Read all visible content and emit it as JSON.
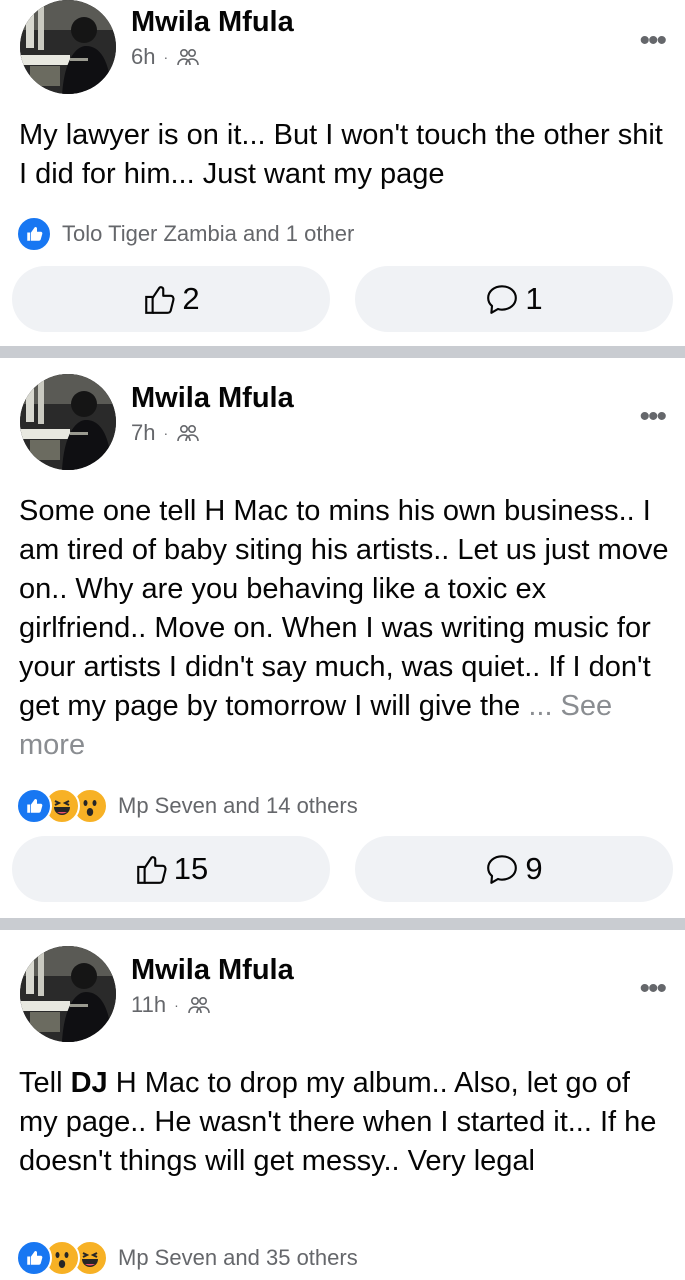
{
  "posts": [
    {
      "author": "Mwila Mfula",
      "time": "6h",
      "text": "My lawyer is on it...  But I won't touch the other shit I did for him...  Just want my page",
      "reactions_text": "Tolo Tiger Zambia and 1 other",
      "reaction_icons": [
        "like-icon"
      ],
      "likes": "2",
      "comments": "1"
    },
    {
      "author": "Mwila Mfula",
      "time": "7h",
      "text": "Some one tell H Mac to mins his own business..  I am tired of baby siting his artists..  Let us just move on..  Why are you behaving like  a toxic ex girlfriend..  Move on. When I was writing music for your artists I didn't say much,  was quiet..  If I don't get my page by tomorrow  I will give the ",
      "see_more": "... See more",
      "reactions_text": "Mp Seven and 14 others",
      "reaction_icons": [
        "like-icon",
        "haha-icon",
        "wow-icon"
      ],
      "likes": "15",
      "comments": "9"
    },
    {
      "author": "Mwila Mfula",
      "time": "11h",
      "text_bold": "DJ",
      "text_pre": "Tell ",
      "text_post": " H Mac to drop my album..  Also,  let go of my page..  He wasn't there when I started it...  If he doesn't things will get messy..  Very legal",
      "reactions_text": "Mp Seven and 35 others",
      "reaction_icons": [
        "like-icon",
        "wow-icon",
        "haha-icon"
      ]
    }
  ],
  "ui": {
    "more_glyph": "•••",
    "meta_dot": "·"
  },
  "colors": {
    "primary": "#1877f2",
    "secondary_text": "#65676b",
    "button_bg": "#f0f2f5",
    "divider": "#c9ccd1",
    "reaction_yellow": "#f7b125"
  }
}
